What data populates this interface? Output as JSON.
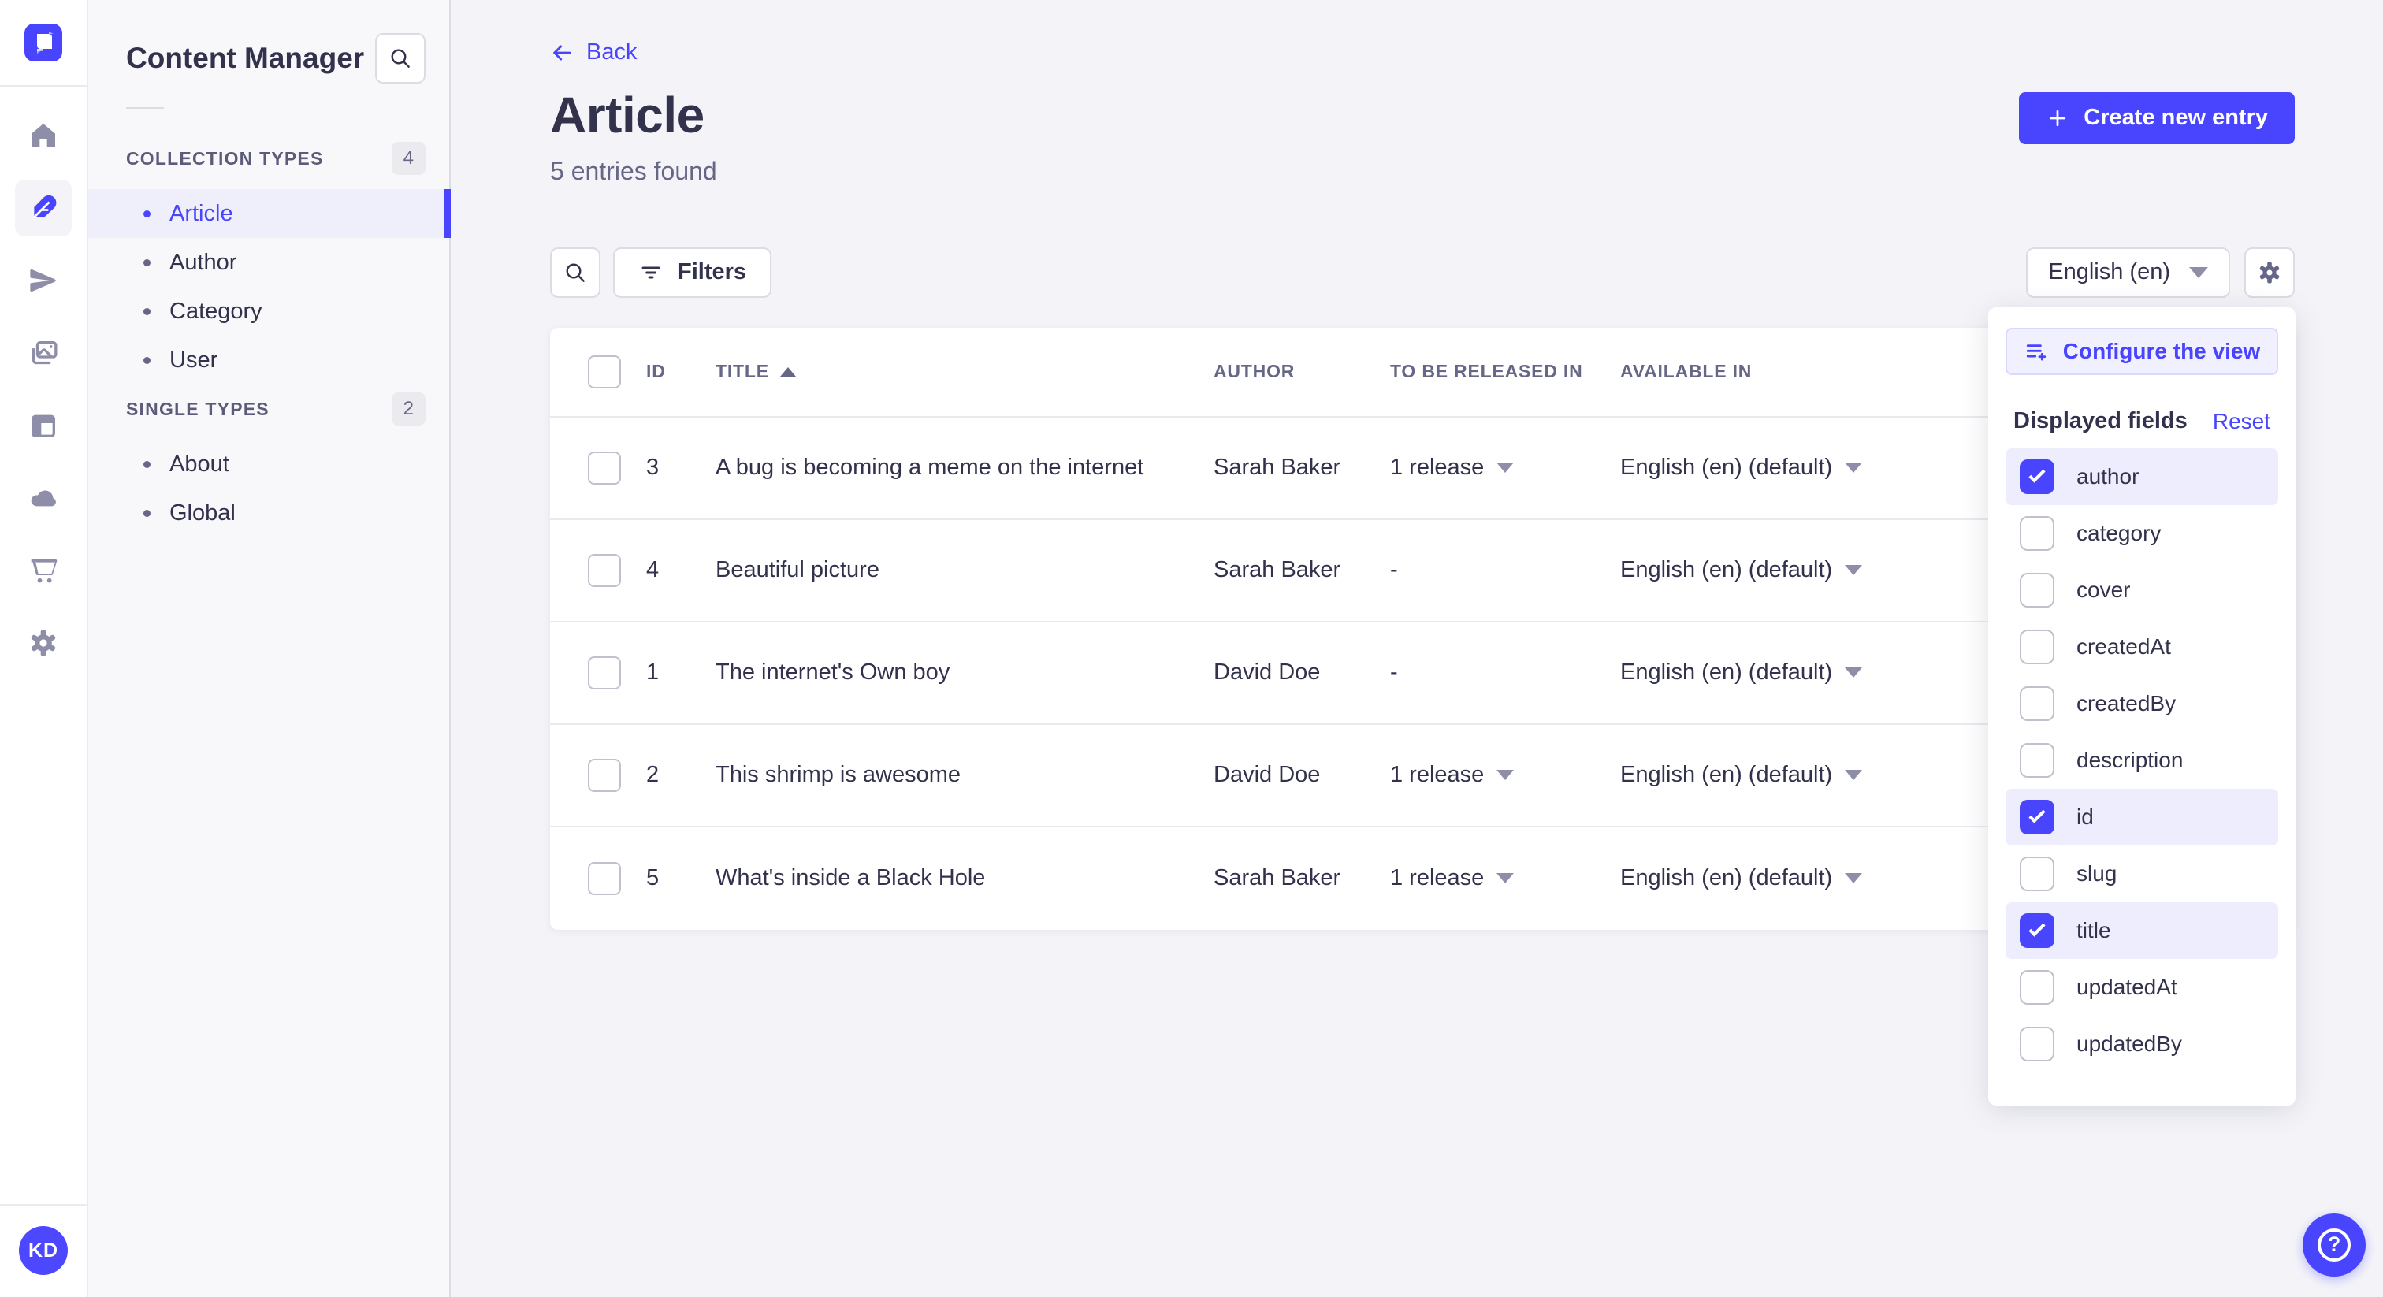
{
  "colors": {
    "primary": "#4945ff",
    "primary_bg": "#f0f0ff",
    "text_dark": "#32324d",
    "text_gray": "#666687"
  },
  "rail": {
    "icons": [
      {
        "name": "strapi-logo"
      },
      {
        "name": "home-icon"
      },
      {
        "name": "content-manager-feather-icon",
        "active": true
      },
      {
        "name": "releases-paper-plane-icon"
      },
      {
        "name": "media-library-images-icon"
      },
      {
        "name": "content-type-builder-layout-icon"
      },
      {
        "name": "deploy-cloud-icon"
      },
      {
        "name": "marketplace-cart-icon"
      },
      {
        "name": "settings-gear-icon"
      }
    ],
    "user_initials": "KD"
  },
  "subnav": {
    "title": "Content Manager",
    "sections": [
      {
        "label": "COLLECTION TYPES",
        "count": "4",
        "items": [
          {
            "label": "Article",
            "active": true
          },
          {
            "label": "Author"
          },
          {
            "label": "Category"
          },
          {
            "label": "User"
          }
        ]
      },
      {
        "label": "SINGLE TYPES",
        "count": "2",
        "items": [
          {
            "label": "About"
          },
          {
            "label": "Global"
          }
        ]
      }
    ]
  },
  "header": {
    "back_label": "Back",
    "title": "Article",
    "subtitle": "5 entries found",
    "create_label": "Create new entry"
  },
  "toolbar": {
    "filters_label": "Filters",
    "locale_value": "English (en)"
  },
  "table": {
    "headers": {
      "id": "ID",
      "title": "TITLE",
      "author": "AUTHOR",
      "released": "TO BE RELEASED IN",
      "available": "AVAILABLE IN"
    },
    "sorted_by": "TITLE ascending",
    "rows": [
      {
        "id": "3",
        "title": "A bug is becoming a meme on the internet",
        "author": "Sarah Baker",
        "released": "1 release",
        "has_release": true,
        "available": "English (en) (default)"
      },
      {
        "id": "4",
        "title": "Beautiful picture",
        "author": "Sarah Baker",
        "released": "-",
        "has_release": false,
        "available": "English (en) (default)"
      },
      {
        "id": "1",
        "title": "The internet's Own boy",
        "author": "David Doe",
        "released": "-",
        "has_release": false,
        "available": "English (en) (default)"
      },
      {
        "id": "2",
        "title": "This shrimp is awesome",
        "author": "David Doe",
        "released": "1 release",
        "has_release": true,
        "available": "English (en) (default)"
      },
      {
        "id": "5",
        "title": "What's inside a Black Hole",
        "author": "Sarah Baker",
        "released": "1 release",
        "has_release": true,
        "available": "English (en) (default)"
      }
    ]
  },
  "popover": {
    "configure_label": "Configure the view",
    "fields_label": "Displayed fields",
    "reset_label": "Reset",
    "fields": [
      {
        "label": "author",
        "checked": true
      },
      {
        "label": "category",
        "checked": false
      },
      {
        "label": "cover",
        "checked": false
      },
      {
        "label": "createdAt",
        "checked": false
      },
      {
        "label": "createdBy",
        "checked": false
      },
      {
        "label": "description",
        "checked": false
      },
      {
        "label": "id",
        "checked": true
      },
      {
        "label": "slug",
        "checked": false
      },
      {
        "label": "title",
        "checked": true
      },
      {
        "label": "updatedAt",
        "checked": false
      },
      {
        "label": "updatedBy",
        "checked": false
      }
    ]
  },
  "fab": {
    "help_glyph": "?"
  }
}
